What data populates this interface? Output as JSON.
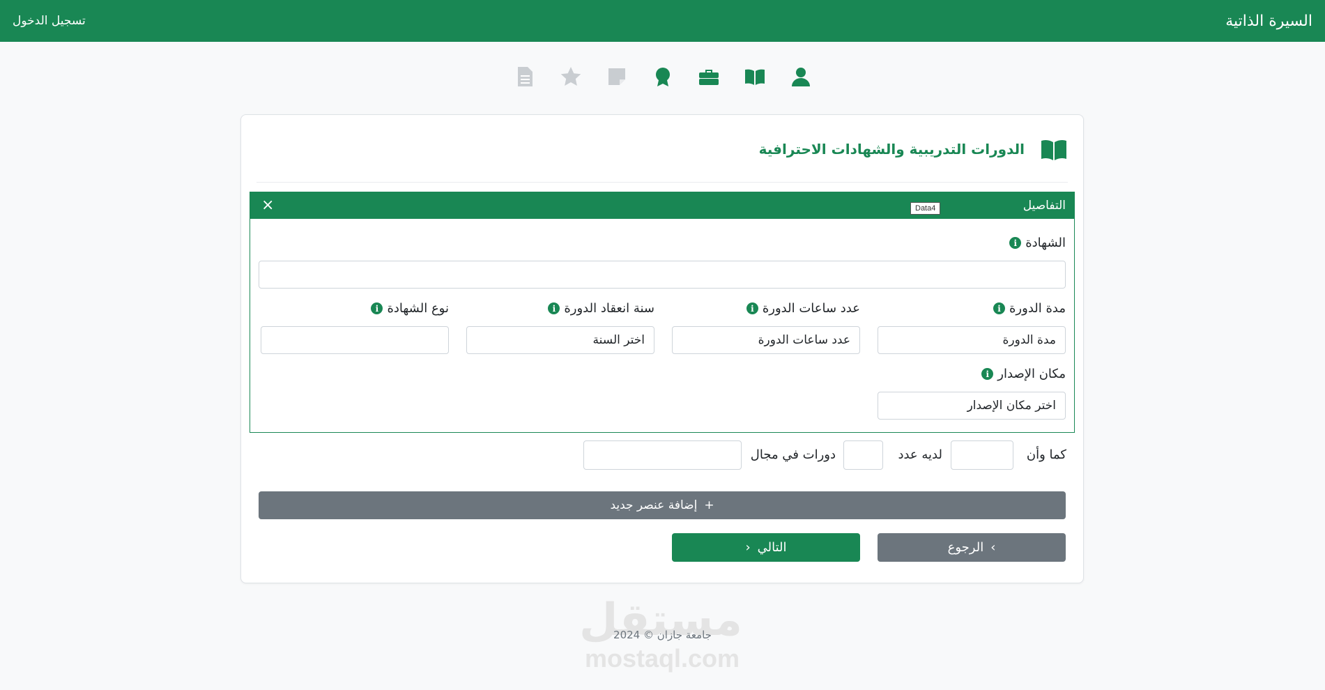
{
  "topbar": {
    "brand": "السيرة الذاتية",
    "login": "تسجيل الدخول"
  },
  "steps": [
    {
      "icon": "person-icon",
      "state": "active"
    },
    {
      "icon": "book-icon",
      "state": "active"
    },
    {
      "icon": "briefcase-icon",
      "state": "active"
    },
    {
      "icon": "certificate-badge-icon",
      "state": "active"
    },
    {
      "icon": "sticky-note-icon",
      "state": "inactive"
    },
    {
      "icon": "star-icon",
      "state": "inactive"
    },
    {
      "icon": "document-icon",
      "state": "inactive"
    }
  ],
  "section": {
    "title": "الدورات التدريبية والشهادات الاحترافية",
    "icon": "book-icon"
  },
  "panel": {
    "title": "التفاصيل",
    "close": "×",
    "tooltip": "Data4"
  },
  "fields": {
    "certificate": {
      "label": "الشهادة",
      "value": ""
    },
    "duration": {
      "label": "مدة الدورة",
      "value": "مدة الدورة"
    },
    "hours": {
      "label": "عدد ساعات الدورة",
      "value": "عدد ساعات الدورة"
    },
    "year": {
      "label": "سنة انعقاد الدورة",
      "value": "اختر السنة"
    },
    "cert_type": {
      "label": "نوع الشهادة",
      "value": ""
    },
    "issue_place": {
      "label": "مكان الإصدار",
      "value": "اختر مكان الإصدار"
    }
  },
  "summary": {
    "text1": "كما وأن",
    "text2": "لديه عدد",
    "text3": "دورات في مجال"
  },
  "buttons": {
    "add": "إضافة عنصر جديد",
    "add_icon": "+",
    "back": "الرجوع",
    "next": "التالي"
  },
  "footer": {
    "copyright": "جامعة جازان © 2024"
  },
  "watermark": {
    "arabic": "مستقل",
    "latin": "mostaql.com"
  },
  "colors": {
    "primary": "#198754",
    "secondary": "#6c757d",
    "inactive_icon": "#c9cdd1"
  }
}
